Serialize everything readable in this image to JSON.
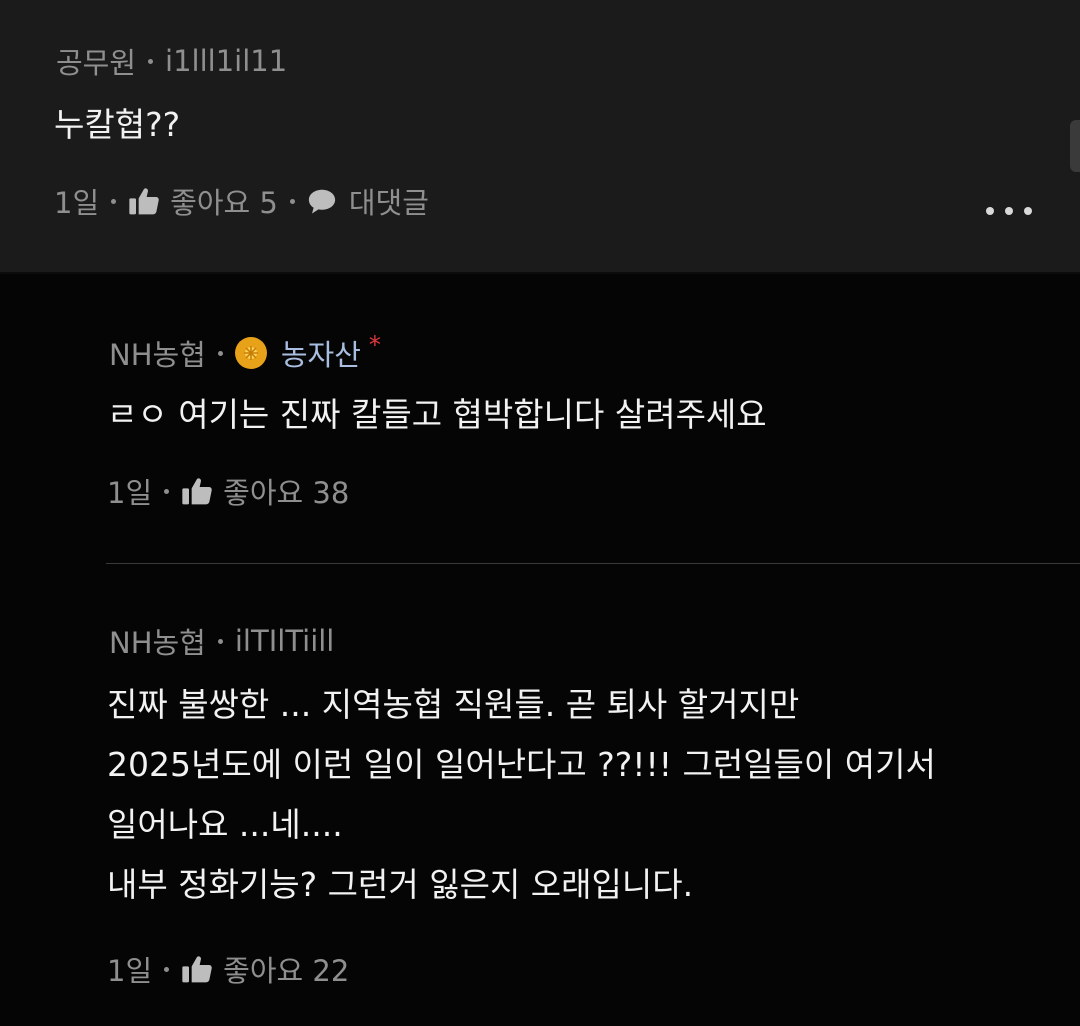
{
  "comments": [
    {
      "affiliation": "공무원",
      "nickname": "i1lll1il11",
      "text_lines": [
        "누칼협??"
      ],
      "time": "1일",
      "like_label": "좋아요 5",
      "reply_label": "대댓글"
    }
  ],
  "replies": [
    {
      "affiliation": "NH농협",
      "nickname": "농자산",
      "badge_icon": "gold-star-badge",
      "marker": "*",
      "text_lines": [
        "ㄹㅇ 여기는 진짜 칼들고 협박합니다 살려주세요"
      ],
      "time": "1일",
      "like_label": "좋아요 38"
    },
    {
      "affiliation": "NH농협",
      "nickname": "ilTIlTiill",
      "text_lines": [
        "진짜 불쌍한 ... 지역농협 직원들.  곧 퇴사 할거지만",
        "2025년도에 이런 일이 일어난다고 ??!!! 그런일들이 여기서",
        "일어나요 ...네....",
        "내부 정화기능? 그런거 잃은지 오래입니다."
      ],
      "time": "1일",
      "like_label": "좋아요 22"
    }
  ],
  "colors": {
    "page_bg": "#050505",
    "top_comment_bg": "#1b1b1b",
    "meta_text": "#8f8f8f",
    "body_text": "#f2f2f2",
    "special_name": "#a8bde0",
    "marker": "#e0383e",
    "badge": "#e8a21a"
  }
}
